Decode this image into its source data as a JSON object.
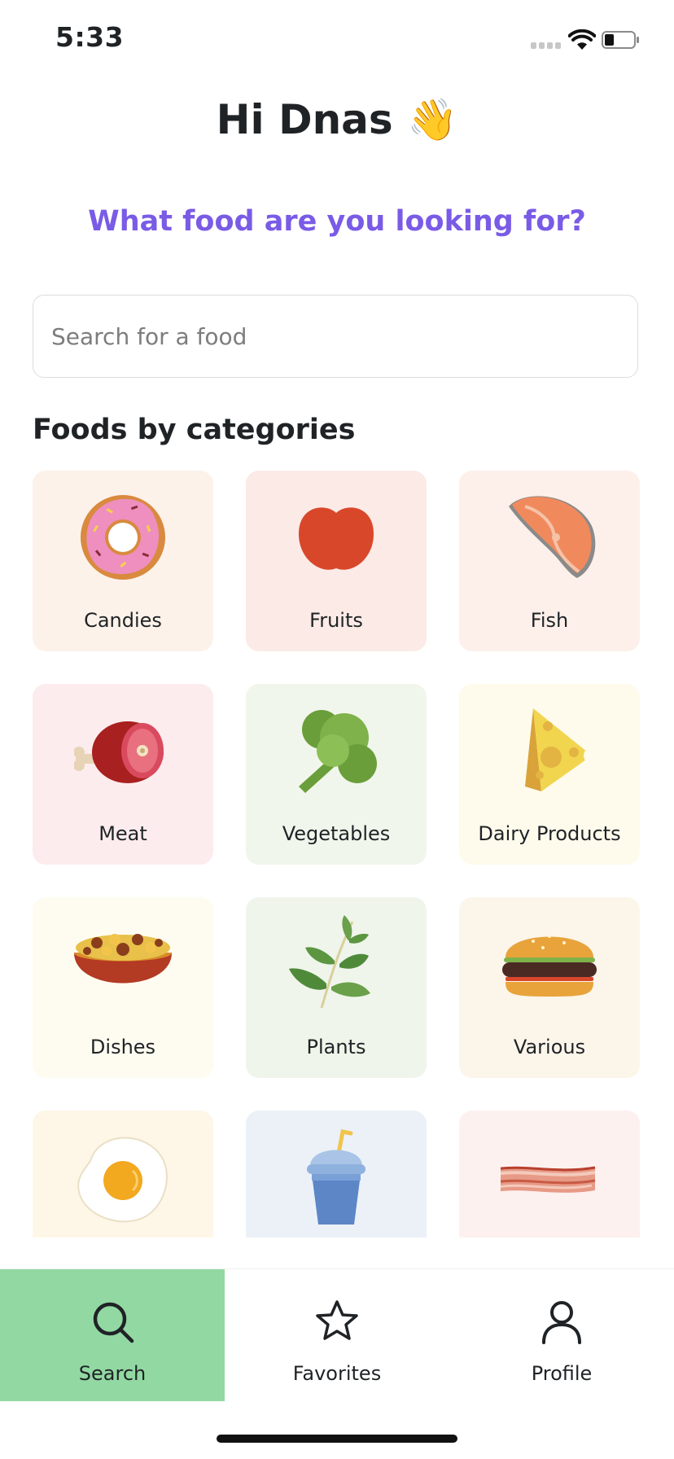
{
  "status_bar": {
    "time": "5:33"
  },
  "header": {
    "greeting": "Hi Dnas 👋",
    "question": "What food are you looking for?"
  },
  "search": {
    "placeholder": "Search for a food",
    "value": ""
  },
  "categories": {
    "title": "Foods by categories",
    "items": [
      {
        "label": "Candies",
        "icon": "donut-icon",
        "bg": "#fcf2ea"
      },
      {
        "label": "Fruits",
        "icon": "apple-icon",
        "bg": "#fbeae6"
      },
      {
        "label": "Fish",
        "icon": "salmon-steak-icon",
        "bg": "#fdf0ea"
      },
      {
        "label": "Meat",
        "icon": "ham-leg-icon",
        "bg": "#fcecee"
      },
      {
        "label": "Vegetables",
        "icon": "broccoli-icon",
        "bg": "#f1f6ec"
      },
      {
        "label": "Dairy Products",
        "icon": "cheese-icon",
        "bg": "#fefbec"
      },
      {
        "label": "Dishes",
        "icon": "bowl-dish-icon",
        "bg": "#fefcf0"
      },
      {
        "label": "Plants",
        "icon": "herb-sprig-icon",
        "bg": "#eff5eb"
      },
      {
        "label": "Various",
        "icon": "burger-icon",
        "bg": "#fcf5ea"
      },
      {
        "label": "",
        "icon": "fried-egg-icon",
        "bg": "#fef7e8"
      },
      {
        "label": "",
        "icon": "drink-cup-icon",
        "bg": "#ecf1f8"
      },
      {
        "label": "",
        "icon": "bacon-icon",
        "bg": "#fdf1f0"
      }
    ]
  },
  "tabbar": {
    "tabs": [
      {
        "label": "Search",
        "icon": "search-icon",
        "active": true
      },
      {
        "label": "Favorites",
        "icon": "star-icon",
        "active": false
      },
      {
        "label": "Profile",
        "icon": "user-icon",
        "active": false
      }
    ]
  },
  "colors": {
    "accent": "#7a5be6",
    "active_tab": "#92d8a2"
  }
}
